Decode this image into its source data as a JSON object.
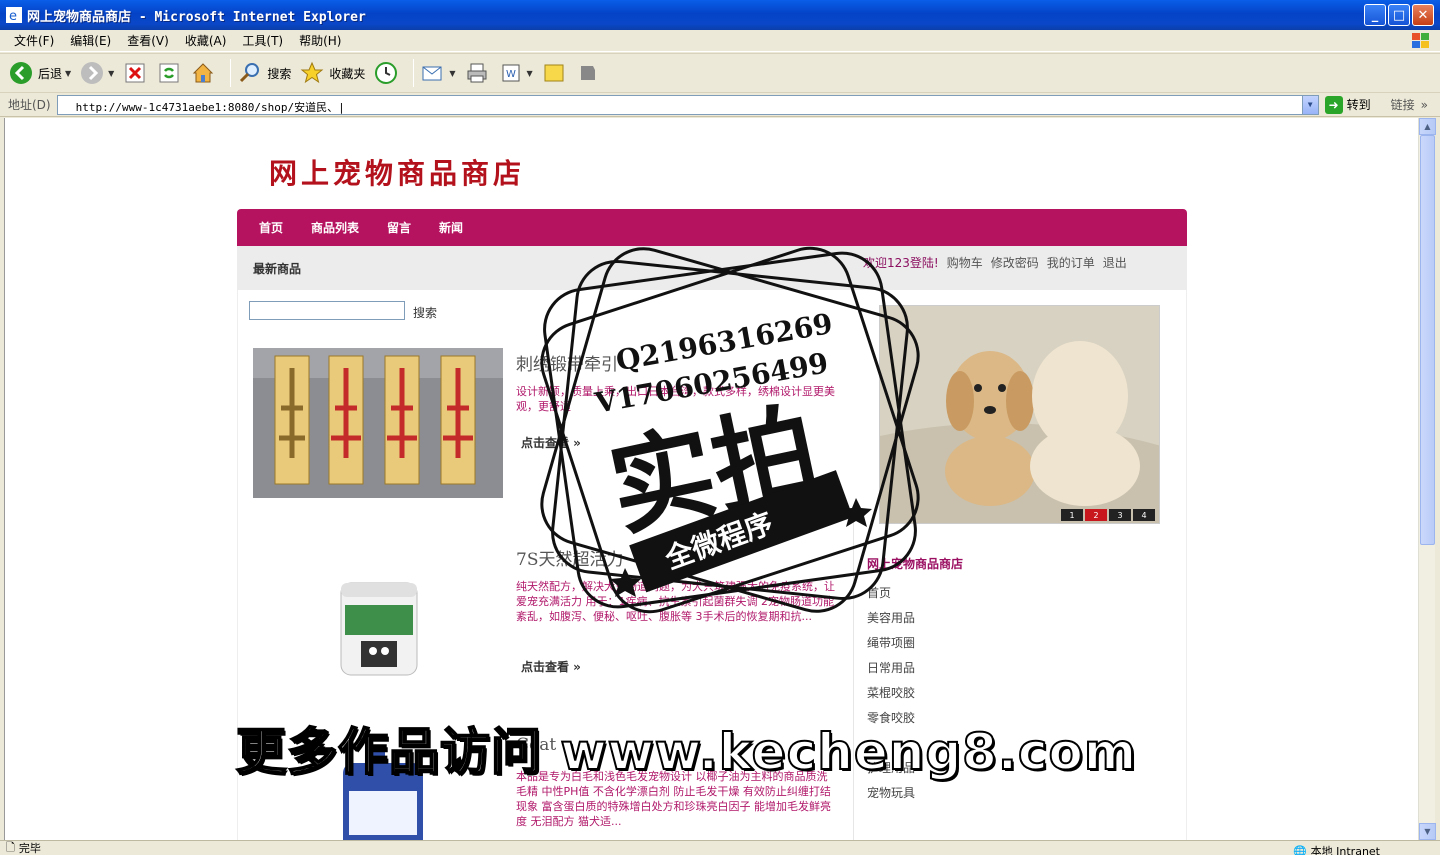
{
  "window": {
    "title": "网上宠物商品商店 - Microsoft Internet Explorer",
    "min_label": "_",
    "max_label": "□",
    "close_label": "✕"
  },
  "menu": [
    "文件(F)",
    "编辑(E)",
    "查看(V)",
    "收藏(A)",
    "工具(T)",
    "帮助(H)"
  ],
  "toolbar": {
    "back_label": "后退",
    "search_label": "搜索",
    "favorites_label": "收藏夹"
  },
  "address": {
    "label": "地址(D)",
    "url": "http://www-1c4731aebe1:8080/shop/安道民、|",
    "go_label": "转到",
    "links_label": "链接"
  },
  "site": {
    "logo": "网上宠物商品商店",
    "nav": [
      "首页",
      "商品列表",
      "留言",
      "新闻"
    ],
    "latest_label": "最新商品",
    "welcome": "欢迎123登陆!",
    "user_links": [
      "购物车",
      "修改密码",
      "我的订单",
      "退出"
    ],
    "search_button": "搜索",
    "search_value": ""
  },
  "products": [
    {
      "title": "刺绣锻带牵引",
      "desc": "设计新颖，质量上乘，出口日本台湾，款式多样，绣棉设计显更美观，更舒适",
      "more": "点击查看 »"
    },
    {
      "title": "7S天然超活力",
      "desc": "纯天然配方，解决犬只肠道问题，为犬只筑建强大的免疫系统，让爱宠充满活力 用于：1疾病、抗生素引起菌群失调 2宠物肠道功能紊乱，如腹泻、便秘、呕吐、腹胀等 3手术后的恢复期和抗...",
      "more": "点击查看 »"
    },
    {
      "title": "Coat",
      "desc": "本品是专为白毛和浅色毛发宠物设计 以椰子油为主料的商品质洗毛精 中性PH值 不含化学漂白剂 防止毛发干燥 有效防止纠缠打结现象 富含蛋白质的特殊增白处方和珍珠亮白因子 能增加毛发鲜亮度 无泪配方 猫犬适...",
      "more": ""
    }
  ],
  "banner": {
    "pages": [
      "1",
      "2",
      "3",
      "4"
    ],
    "active_index": 1
  },
  "sidebar": {
    "heading": "网上宠物商品商店",
    "categories": [
      "首页",
      "美容用品",
      "绳带项圈",
      "日常用品",
      "菜棍咬胶",
      "零食咬胶",
      "",
      "护理用品",
      "宠物玩具"
    ]
  },
  "watermark": {
    "qq": "Q2196316269",
    "phone": "V17060256499",
    "big": "实拍",
    "ribbon": "全微程序"
  },
  "promo": "更多作品访问 www.kecheng8.com",
  "status": {
    "left": "完毕",
    "zone": "本地 Intranet"
  },
  "colors": {
    "nav_bg": "#b5135f",
    "logo": "#b3121c",
    "desc": "#b0186a"
  }
}
